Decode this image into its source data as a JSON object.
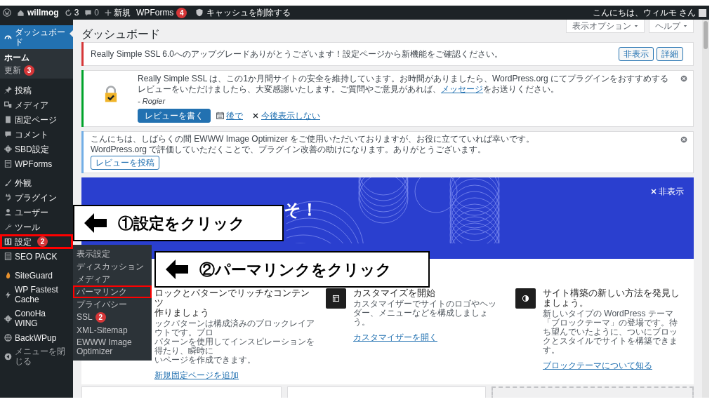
{
  "admin_bar": {
    "site": "willmog",
    "updates": "3",
    "comments": "0",
    "new": "新規",
    "wpforms": "WPForms",
    "wpforms_badge": "4",
    "cache": "キャッシュを削除する",
    "greeting": "こんにちは、ウィルモ さん"
  },
  "sidebar": {
    "groups": [
      [
        {
          "label": "ダッシュボード",
          "selected": true,
          "highlighted": false,
          "children": [
            {
              "label": "ホーム",
              "selected": true
            },
            {
              "label": "更新",
              "badge": "3",
              "selected": false
            }
          ]
        }
      ],
      [
        {
          "label": "投稿",
          "selected": false,
          "highlighted": false
        },
        {
          "label": "メディア",
          "selected": false,
          "highlighted": false
        },
        {
          "label": "固定ページ",
          "selected": false,
          "highlighted": false
        },
        {
          "label": "コメント",
          "selected": false,
          "highlighted": false
        },
        {
          "label": "SBD設定",
          "selected": false,
          "highlighted": false
        },
        {
          "label": "WPForms",
          "selected": false,
          "highlighted": false
        }
      ],
      [
        {
          "label": "外観",
          "selected": false,
          "highlighted": false
        },
        {
          "label": "プラグイン",
          "selected": false,
          "highlighted": false
        },
        {
          "label": "ユーザー",
          "selected": false,
          "highlighted": false
        },
        {
          "label": "ツール",
          "selected": false,
          "highlighted": false
        },
        {
          "label": "設定",
          "badge": "2",
          "selected": false,
          "highlighted": true
        },
        {
          "label": "SEO PACK",
          "selected": false,
          "highlighted": false
        }
      ],
      [
        {
          "label": "SiteGuard",
          "selected": false,
          "highlighted": false
        },
        {
          "label": "WP Fastest Cache",
          "selected": false,
          "highlighted": false
        },
        {
          "label": "ConoHa WING",
          "selected": false,
          "highlighted": false
        },
        {
          "label": "BackWPup",
          "selected": false,
          "highlighted": false
        }
      ]
    ],
    "collapse": "メニューを閉じる"
  },
  "flyout": {
    "items": [
      {
        "label": "表示設定",
        "highlighted": false
      },
      {
        "label": "ディスカッション",
        "highlighted": false
      },
      {
        "label": "メディア",
        "highlighted": false
      },
      {
        "label": "パーマリンク",
        "highlighted": true
      },
      {
        "label": "プライバシー",
        "highlighted": false
      },
      {
        "label": "SSL",
        "badge": "2",
        "highlighted": false
      },
      {
        "label": "XML-Sitemap",
        "highlighted": false
      },
      {
        "label": "EWWW Image Optimizer",
        "highlighted": false
      }
    ]
  },
  "page_title": "ダッシュボード",
  "screen_options": "表示オプション",
  "help": "ヘルプ",
  "notices": [
    {
      "kind": "upgrade",
      "color": "#d63638",
      "text": "Really Simple SSL 6.0へのアップグレードありがとうございます！設定ページから新機能をご確認ください。",
      "buttons": [
        "非表示",
        "詳細"
      ]
    },
    {
      "kind": "review",
      "color": "#00a32a",
      "text": "Really Simple SSL は、この1か月間サイトの安全を維持しています。お時間がありましたら、WordPress.org にてプラグインをおすすめするレビューをいただけましたら、大変感謝いたします。ご質問やご意見があれば、",
      "link": "メッセージ",
      "text_after": "をお送りください。",
      "signature": "- Rogier",
      "primary_button": "レビューを書く",
      "later": "後で",
      "never": "今後表示しない",
      "dismissible": true
    },
    {
      "kind": "rating",
      "color": "#72aee6",
      "lines": [
        "こんにちは、しばらくの間 EWWW Image Optimizer をご使用いただいておりますが、お役に立てていれば幸いです。",
        "WordPress.org で評価していただくことで、プラグイン改善の助けになります。ありがとうございます。"
      ],
      "button": "レビューを投稿",
      "dismissible": true
    }
  ],
  "welcome": {
    "heading": "そ！",
    "dismiss": "非表示",
    "cards": [
      {
        "icon": false,
        "heading_lines": [
          "ロックとパターンでリッチなコンテンツ",
          "作りましょう"
        ],
        "description_lines": [
          "ックパターンは構成済みのブロックレイアウトです。ブロ",
          "パターンを使用してインスピレーションを得たり、瞬時に",
          "いページを作成できます。"
        ],
        "link": "新規固定ページを追加"
      },
      {
        "icon": true,
        "heading_lines": [
          "カスタマイズを開始"
        ],
        "description_lines": [
          "カスタマイザーでサイトのロゴやヘッダー、メニューなどを構成しましょう。"
        ],
        "link": "カスタマイザーを開く"
      },
      {
        "icon": true,
        "heading_lines": [
          "サイト構築の新しい方法を発見しましょう。"
        ],
        "description_lines": [
          "新しいタイプの WordPress テーマ「ブロックテーマ」の登場です。待ち望んでいたように、ついにブロックとスタイルでサイトを構築できます。"
        ],
        "link": "ブロックテーマについて知る"
      }
    ]
  },
  "callouts": [
    {
      "text": "①設定をクリック"
    },
    {
      "text": "②パーマリンクをクリック"
    }
  ]
}
